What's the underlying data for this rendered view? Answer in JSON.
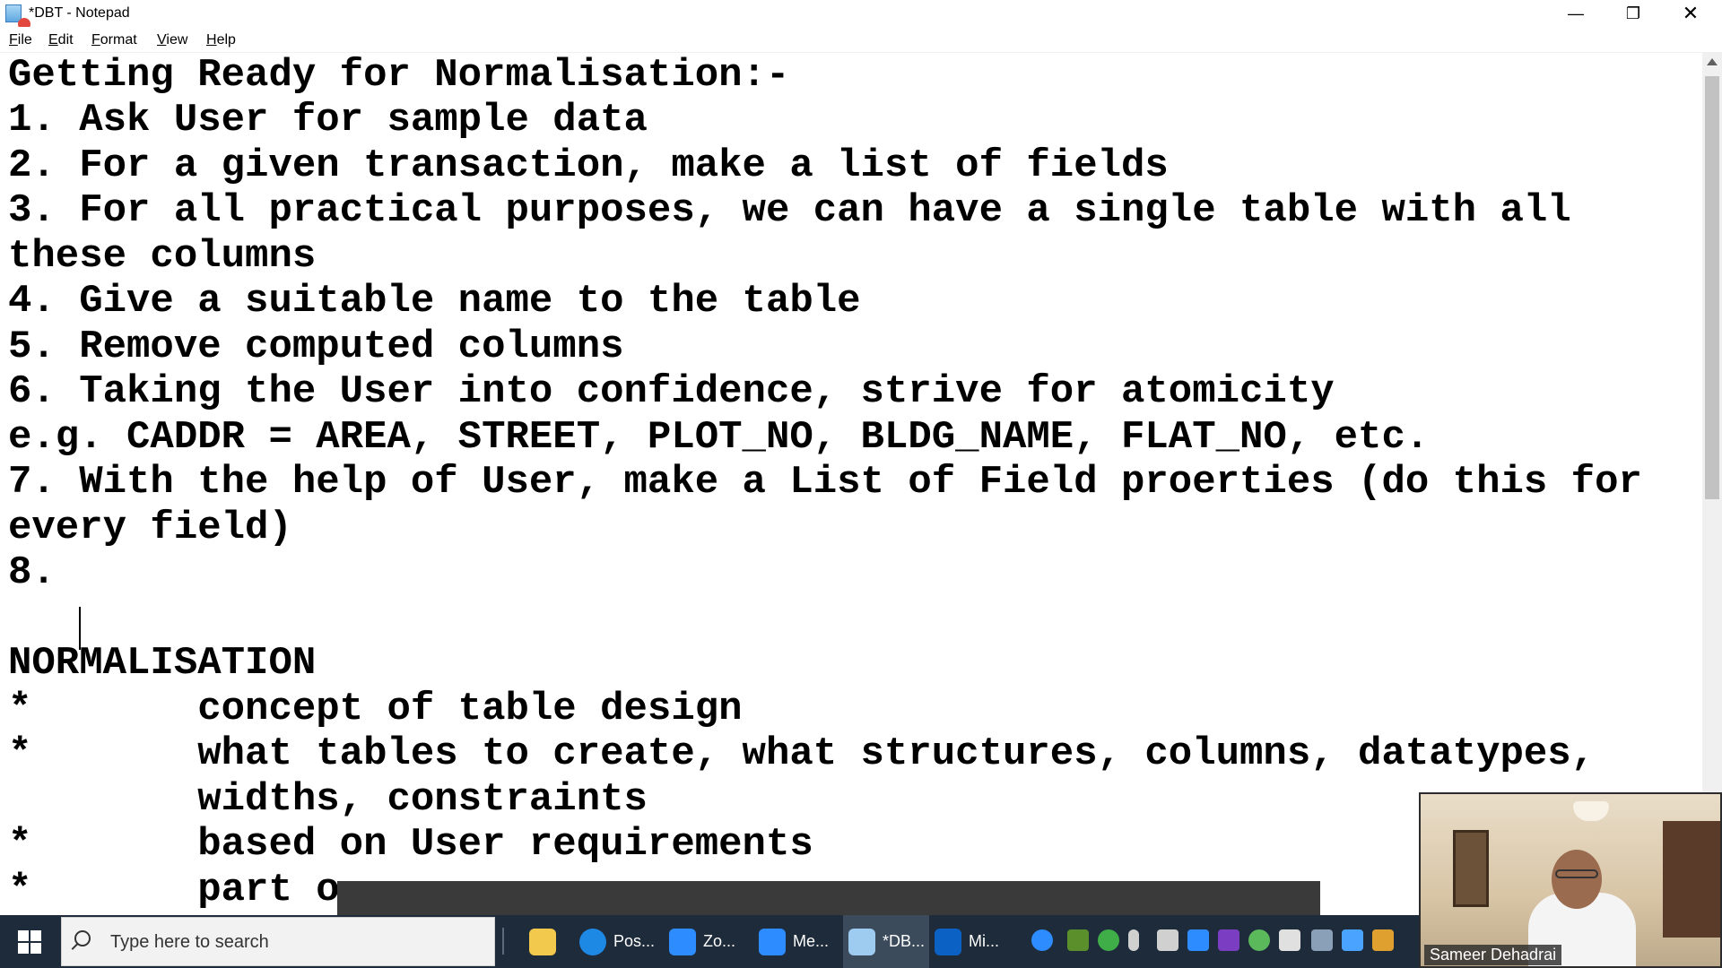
{
  "window": {
    "title": "*DBT - Notepad",
    "controls": {
      "minimize": "—",
      "maximize": "❐",
      "close": "✕"
    }
  },
  "menu": {
    "items": [
      {
        "first": "F",
        "rest": "ile"
      },
      {
        "first": "E",
        "rest": "dit"
      },
      {
        "first": "F",
        "rest": "ormat"
      },
      {
        "first": "V",
        "rest": "iew"
      },
      {
        "first": "H",
        "rest": "elp"
      }
    ]
  },
  "document": {
    "lines": [
      "Getting Ready for Normalisation:-",
      "1. Ask User for sample data",
      "2. For a given transaction, make a list of fields",
      "3. For all practical purposes, we can have a single table with all",
      "these columns",
      "4. Give a suitable name to the table",
      "5. Remove computed columns",
      "6. Taking the User into confidence, strive for atomicity",
      "e.g. CADDR = AREA, STREET, PLOT_NO, BLDG_NAME, FLAT_NO, etc.",
      "7. With the help of User, make a List of Field proerties (do this for",
      "every field)",
      "8. ",
      "",
      "NORMALISATION",
      "*       concept of table design",
      "*       what tables to create, what structures, columns, datatypes,",
      "        widths, constraints",
      "*       based on User requirements",
      "*       part o"
    ]
  },
  "taskbar": {
    "search_placeholder": "Type here to search",
    "apps": [
      {
        "label": "",
        "icon": "file-explorer-icon",
        "color": "#f2c94c"
      },
      {
        "label": "Pos...",
        "icon": "edge-browser-icon",
        "color": "#1e88e5"
      },
      {
        "label": "Zo...",
        "icon": "zoom-icon",
        "color": "#2d8cff"
      },
      {
        "label": "Me...",
        "icon": "zoom-meeting-icon",
        "color": "#2d8cff"
      },
      {
        "label": "*DB...",
        "icon": "notepad-icon",
        "color": "#9ecbf0"
      },
      {
        "label": "Mi...",
        "icon": "whiteboard-icon",
        "color": "#0b62c4"
      }
    ],
    "tray_icons": [
      "help-icon",
      "nvidia-icon",
      "check-icon",
      "microphone-icon",
      "folder-icon",
      "video-icon",
      "onenote-icon",
      "sync-icon",
      "shield-icon",
      "network-icon",
      "bluetooth-icon",
      "app-icon",
      "color-icon"
    ]
  },
  "webcam": {
    "participant_name": "Sameer Dehadrai"
  }
}
